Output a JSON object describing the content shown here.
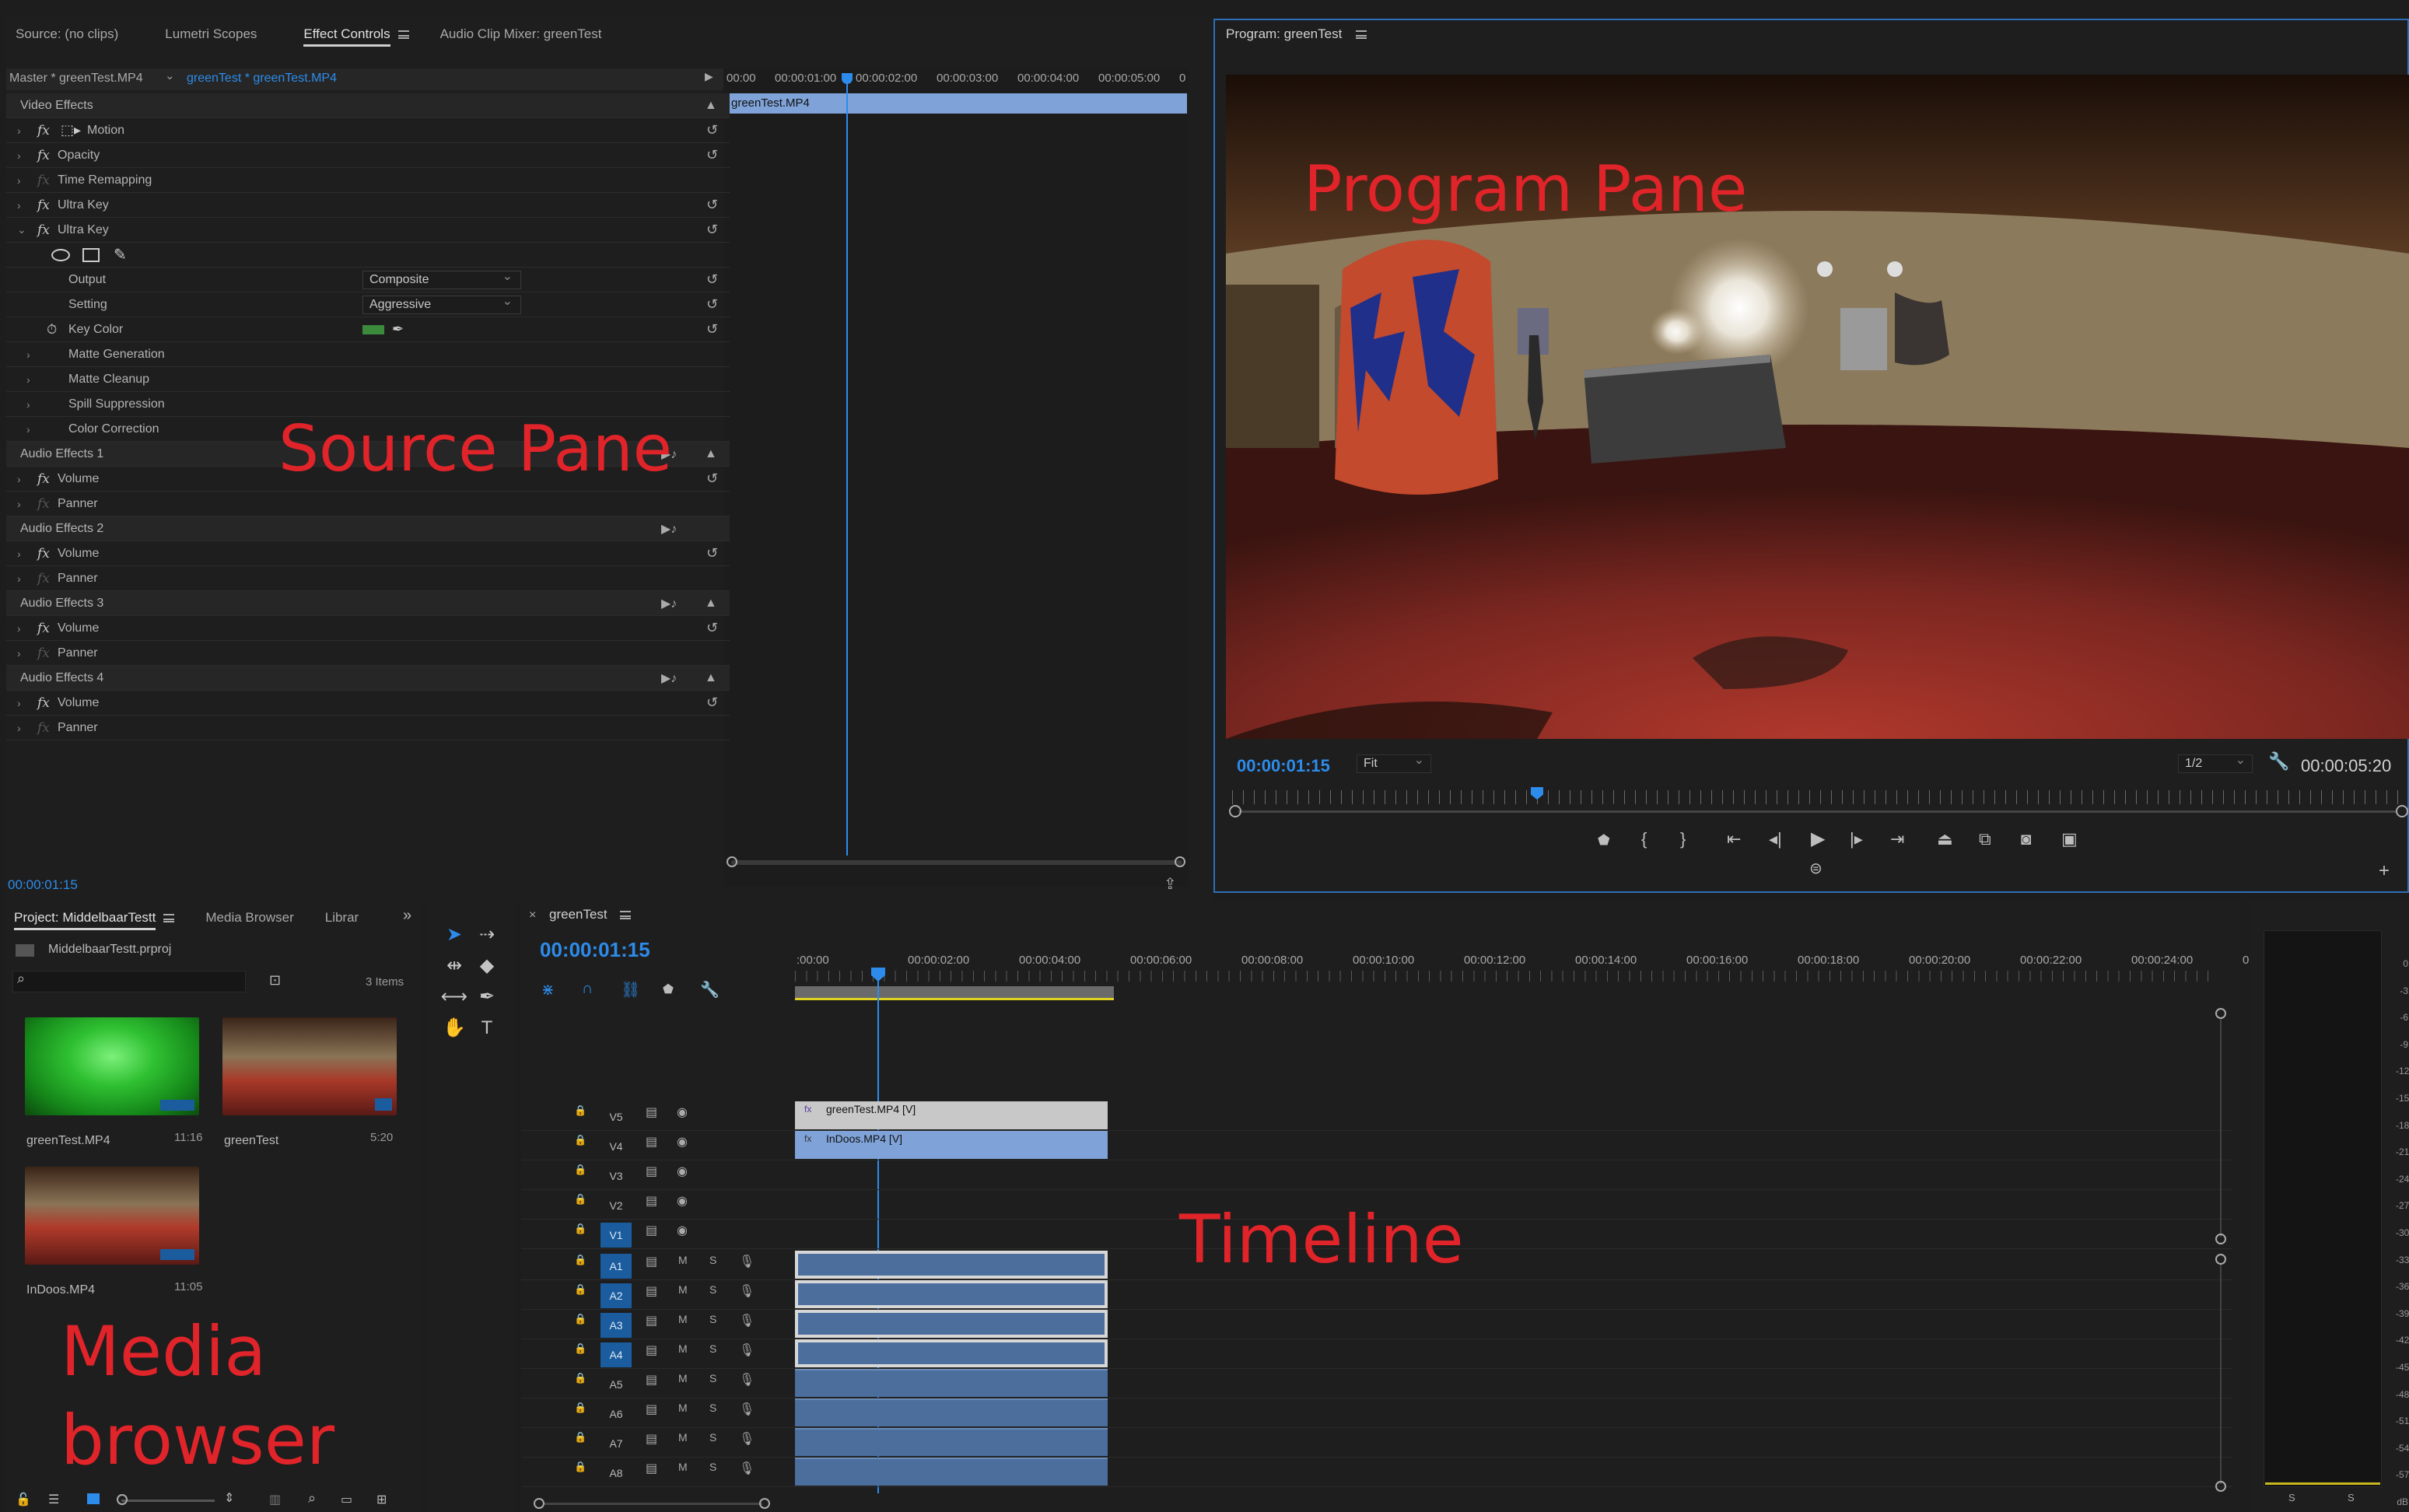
{
  "source_tabs": [
    "Source: (no clips)",
    "Lumetri Scopes",
    "Effect Controls",
    "Audio Clip Mixer: greenTest"
  ],
  "program_title": "Program: greenTest",
  "effect_controls": {
    "master_label": "Master * greenTest.MP4",
    "clip_label": "greenTest * greenTest.MP4",
    "ruler": [
      "00:00",
      "00:00:01:00",
      "00:00:02:00",
      "00:00:03:00",
      "00:00:04:00",
      "00:00:05:00",
      "0"
    ],
    "clip_bar": "greenTest.MP4",
    "video_effects": "Video Effects",
    "motion": "Motion",
    "opacity": "Opacity",
    "time_remapping": "Time Remapping",
    "ultra_key_1": "Ultra Key",
    "ultra_key_2": "Ultra Key",
    "output_label": "Output",
    "output_value": "Composite",
    "setting_label": "Setting",
    "setting_value": "Aggressive",
    "key_color_label": "Key Color",
    "key_color": "#3c8a3c",
    "matte_generation": "Matte Generation",
    "matte_cleanup": "Matte Cleanup",
    "spill_suppression": "Spill Suppression",
    "color_correction": "Color Correction",
    "audio_effects": [
      "Audio Effects 1",
      "Audio Effects 2",
      "Audio Effects 3",
      "Audio Effects 4"
    ],
    "volume": "Volume",
    "panner": "Panner",
    "timecode": "00:00:01:15"
  },
  "program": {
    "current_time": "00:00:01:15",
    "zoom": "Fit",
    "resolution": "1/2",
    "duration": "00:00:05:20"
  },
  "overlay_labels": {
    "source": "Source Pane",
    "program": "Program Pane",
    "timeline": "Timeline",
    "media_1": "Media",
    "media_2": "browser"
  },
  "project": {
    "tabs": [
      "Project: MiddelbaarTestt",
      "Media Browser",
      "Librar"
    ],
    "file": "MiddelbaarTestt.prproj",
    "items_count": "3 Items",
    "items": [
      {
        "name": "greenTest.MP4",
        "duration": "11:16"
      },
      {
        "name": "greenTest",
        "duration": "5:20"
      },
      {
        "name": "InDoos.MP4",
        "duration": "11:05"
      }
    ]
  },
  "timeline": {
    "sequence": "greenTest",
    "timecode": "00:00:01:15",
    "ruler": [
      ":00:00",
      "00:00:02:00",
      "00:00:04:00",
      "00:00:06:00",
      "00:00:08:00",
      "00:00:10:00",
      "00:00:12:00",
      "00:00:14:00",
      "00:00:16:00",
      "00:00:18:00",
      "00:00:20:00",
      "00:00:22:00",
      "00:00:24:00",
      "00"
    ],
    "video_tracks": [
      "V5",
      "V4",
      "V3",
      "V2",
      "V1"
    ],
    "audio_tracks": [
      "A1",
      "A2",
      "A3",
      "A4",
      "A5",
      "A6",
      "A7",
      "A8"
    ],
    "clip_v5": "greenTest.MP4 [V]",
    "clip_v4": "InDoos.MP4 [V]",
    "mute": "M",
    "solo": "S"
  },
  "meter": {
    "labels": [
      "0",
      "-3",
      "-6",
      "-9",
      "-12",
      "-15",
      "-18",
      "-21",
      "-24",
      "-27",
      "-30",
      "-33",
      "-36",
      "-39",
      "-42",
      "-45",
      "-48",
      "-51",
      "-54",
      "-57",
      "dB"
    ],
    "channels": [
      "S",
      "S"
    ]
  }
}
